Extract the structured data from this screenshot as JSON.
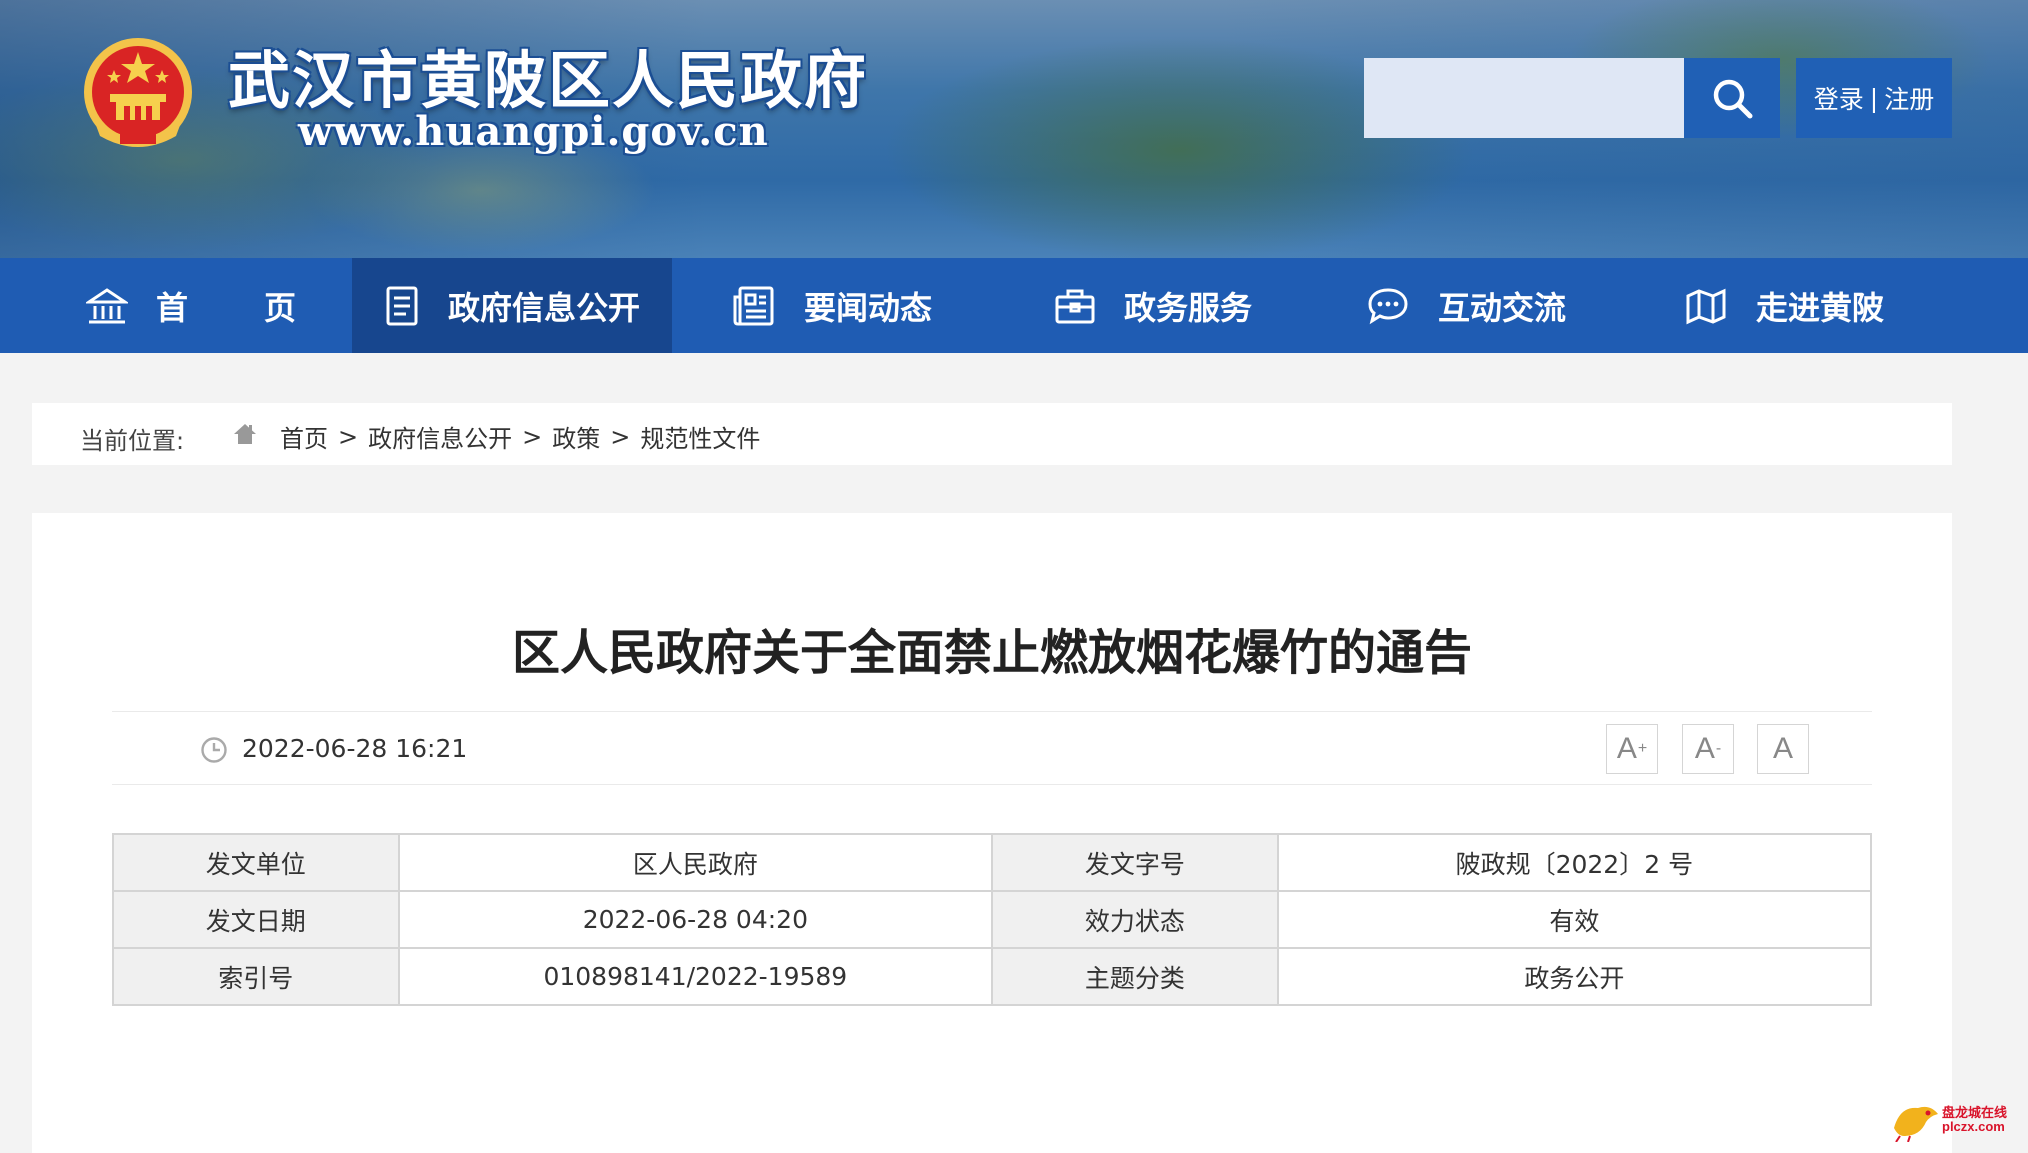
{
  "header": {
    "site_title": "武汉市黄陂区人民政府",
    "site_url": "www.huangpi.gov.cn",
    "search": {
      "placeholder": "",
      "value": ""
    },
    "auth": {
      "login": "登录",
      "separator": "|",
      "register": "注册"
    }
  },
  "nav": {
    "items": [
      {
        "label": "首　　页",
        "icon": "home-icon"
      },
      {
        "label": "政府信息公开",
        "icon": "document-icon"
      },
      {
        "label": "要闻动态",
        "icon": "news-icon"
      },
      {
        "label": "政务服务",
        "icon": "briefcase-icon"
      },
      {
        "label": "互动交流",
        "icon": "chat-icon"
      },
      {
        "label": "走进黄陂",
        "icon": "map-icon"
      }
    ],
    "active": "政府信息公开"
  },
  "breadcrumb": {
    "label": "当前位置:",
    "path": [
      "首页",
      "政府信息公开",
      "政策",
      "规范性文件"
    ],
    "separator": ">"
  },
  "article": {
    "title": "区人民政府关于全面禁止燃放烟花爆竹的通告",
    "publish_time": "2022-06-28 16:21",
    "font_controls": {
      "increase": "A",
      "increase_mark": "+",
      "decrease": "A",
      "decrease_mark": "-",
      "reset": "A"
    },
    "info_table": [
      [
        {
          "key": "发文单位",
          "value": "区人民政府"
        },
        {
          "key": "发文字号",
          "value": "陂政规〔2022〕2 号"
        }
      ],
      [
        {
          "key": "发文日期",
          "value": "2022-06-28 04:20"
        },
        {
          "key": "效力状态",
          "value": "有效"
        }
      ],
      [
        {
          "key": "索引号",
          "value": "010898141/2022-19589"
        },
        {
          "key": "主题分类",
          "value": "政务公开"
        }
      ]
    ]
  },
  "watermark": {
    "line1": "盘龙城在线",
    "line2": "plczx.com"
  },
  "colors": {
    "nav_bg": "#1f5cb3",
    "nav_active": "#17468e",
    "accent": "#2060b5"
  }
}
